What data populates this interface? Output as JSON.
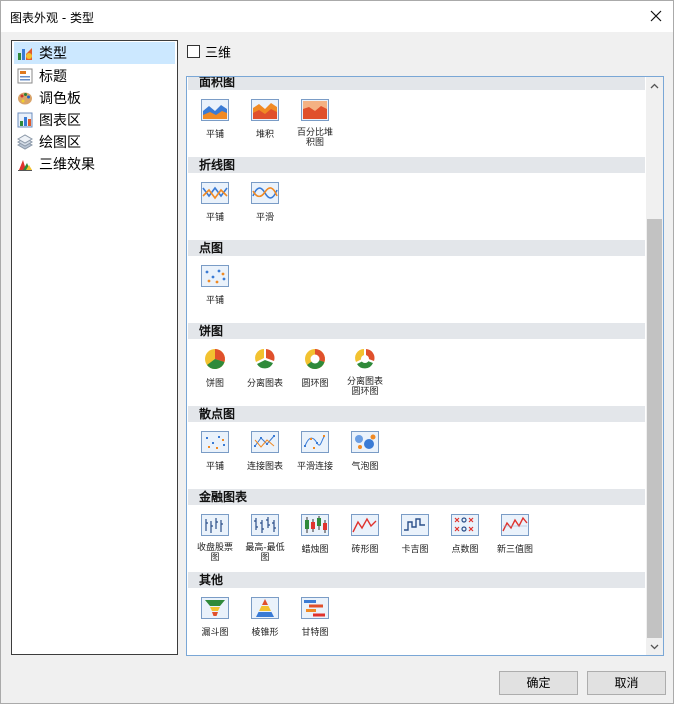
{
  "window": {
    "title": "图表外观 - 类型"
  },
  "tree": {
    "items": [
      {
        "label": "类型",
        "icon": "chart-type-icon"
      },
      {
        "label": "标题",
        "icon": "title-icon"
      },
      {
        "label": "调色板",
        "icon": "palette-icon"
      },
      {
        "label": "图表区",
        "icon": "chart-area-icon"
      },
      {
        "label": "绘图区",
        "icon": "plot-area-icon"
      },
      {
        "label": "三维效果",
        "icon": "3d-effect-icon"
      }
    ],
    "selected": "类型"
  },
  "options": {
    "three_d_label": "三维",
    "three_d_checked": false
  },
  "gallery": {
    "groups": [
      {
        "title": "面积图",
        "items": [
          "平铺",
          "堆积",
          "百分比堆\n积图"
        ]
      },
      {
        "title": "折线图",
        "items": [
          "平铺",
          "平滑"
        ]
      },
      {
        "title": "点图",
        "items": [
          "平铺"
        ]
      },
      {
        "title": "饼图",
        "items": [
          "饼图",
          "分离图表",
          "圆环图",
          "分离图表\n圆环图"
        ]
      },
      {
        "title": "散点图",
        "items": [
          "平铺",
          "连接图表",
          "平滑连接",
          "气泡图"
        ]
      },
      {
        "title": "金融图表",
        "items": [
          "收盘股票\n图",
          "最高-最低\n图",
          "蜡烛图",
          "砖形图",
          "卡吉图",
          "点数图",
          "新三值图"
        ]
      },
      {
        "title": "其他",
        "items": [
          "漏斗图",
          "棱锥形",
          "甘特图"
        ]
      }
    ]
  },
  "buttons": {
    "ok": "确定",
    "cancel": "取消"
  },
  "colors": {
    "selection": "#cce8ff",
    "group_header": "#e3e6ea",
    "gallery_border": "#7aa7d6",
    "icon_blue": "#3a7bd5",
    "icon_orange": "#f08a24"
  }
}
